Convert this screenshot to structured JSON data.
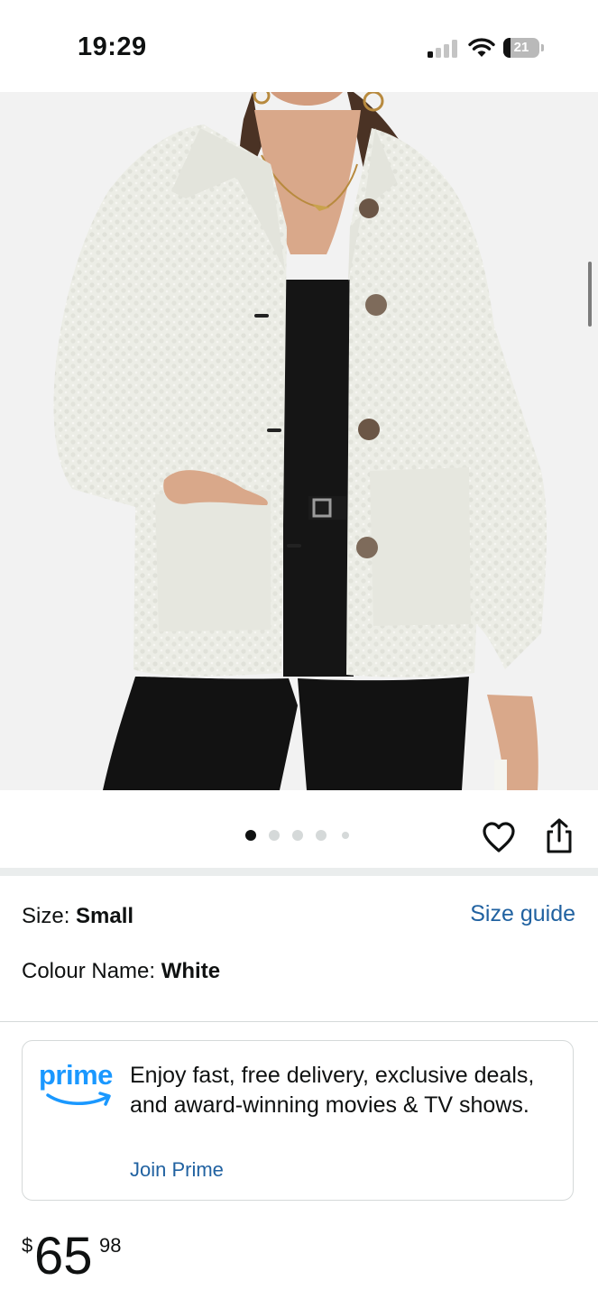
{
  "status_bar": {
    "time": "19:29",
    "battery_level": "21",
    "battery_fraction": 0.21,
    "signal_bars_active": 1,
    "signal_bars_total": 4,
    "icons": [
      "cellular-signal-icon",
      "wifi-icon",
      "battery-icon"
    ]
  },
  "product_image": {
    "carousel_total": 5,
    "carousel_active_index": 0,
    "actions": [
      "heart-icon",
      "share-icon"
    ]
  },
  "variations": {
    "size_label": "Size: ",
    "size_value": "Small",
    "size_guide_link": "Size guide",
    "colour_label": "Colour Name: ",
    "colour_value": "White"
  },
  "prime": {
    "logo_text": "prime",
    "message": "Enjoy fast, free delivery, exclusive deals, and award-winning movies & TV shows.",
    "join_link": "Join Prime"
  },
  "price": {
    "symbol": "$",
    "whole": "65",
    "fraction": "98"
  },
  "colors": {
    "link_blue": "#2162a1",
    "prime_blue": "#1a98ff",
    "text": "#0f1111",
    "divider": "#d5d9d9",
    "jacket": "#ecede6"
  }
}
